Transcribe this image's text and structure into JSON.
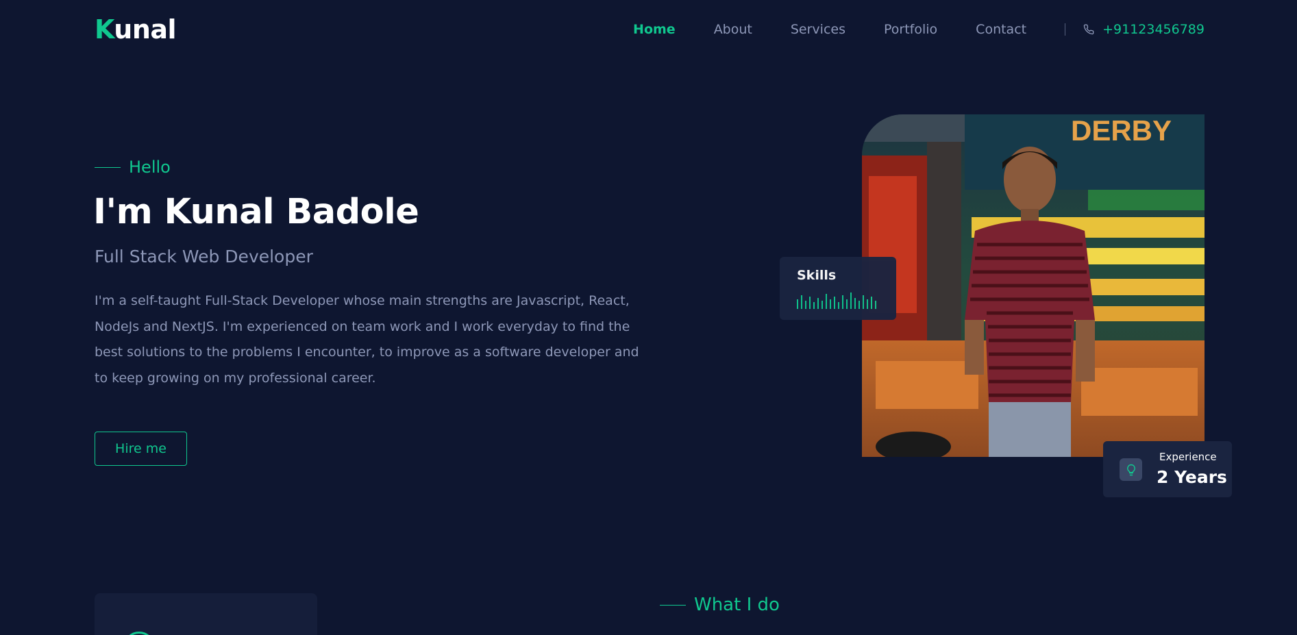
{
  "header": {
    "logo_initial": "K",
    "logo_rest": "unal",
    "nav": [
      "Home",
      "About",
      "Services",
      "Portfolio",
      "Contact"
    ],
    "active_nav": "Home",
    "phone_icon": "phone-icon",
    "phone": "+91123456789"
  },
  "hero": {
    "greeting": "Hello",
    "name": "I'm Kunal Badole",
    "role": "Full Stack Web Developer",
    "bio": "I'm a self-taught Full-Stack Developer whose main strengths are Javascript, React, NodeJs and NextJS. I'm experienced on team work and I work everyday to find the best solutions to the problems I encounter, to improve as a software developer and to keep growing on my professional career.",
    "cta": "Hire me"
  },
  "skills_card": {
    "title": "Skills",
    "icon": "audio-bars-icon"
  },
  "experience_card": {
    "label": "Experience",
    "value": "2 Years",
    "icon": "lightbulb-icon"
  },
  "sections": {
    "services_heading": "What I do"
  },
  "colors": {
    "background": "#0e1630",
    "accent": "#10c88f",
    "muted_text": "#8e98b8",
    "card": "#1a2440"
  }
}
